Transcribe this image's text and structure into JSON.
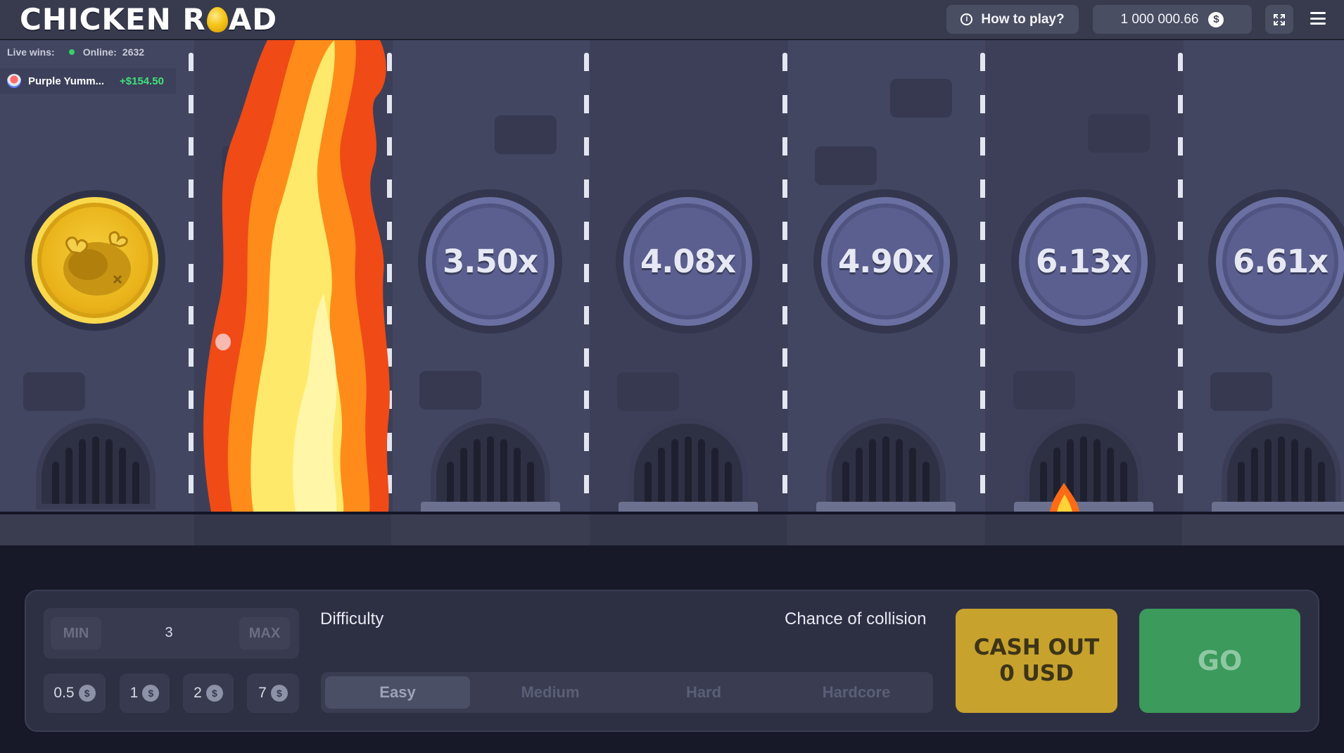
{
  "header": {
    "logo_left": "CHICKEN R",
    "logo_right": "AD",
    "how_to_play": "How to play?",
    "balance": "1 000 000.66",
    "currency_icon": "$"
  },
  "live": {
    "live_wins_label": "Live wins:",
    "online_label": "Online:",
    "online_count": "2632",
    "winner_name": "Purple Yumm...",
    "winner_amount": "+$154.50"
  },
  "lanes": {
    "multipliers": [
      "3.50x",
      "4.08x",
      "4.90x",
      "6.13x",
      "6.61x"
    ]
  },
  "controls": {
    "min_label": "MIN",
    "max_label": "MAX",
    "bet_value": "3",
    "chips": [
      "0.5",
      "1",
      "2",
      "7"
    ],
    "chip_icon": "$",
    "difficulty_label": "Difficulty",
    "collision_label": "Chance of collision",
    "difficulties": [
      "Easy",
      "Medium",
      "Hard",
      "Hardcore"
    ],
    "selected_difficulty": "Easy",
    "cash_out_line1": "CASH OUT",
    "cash_out_line2": "0 USD",
    "go_label": "GO"
  },
  "colors": {
    "background": "#424660",
    "accent_gold": "#c7a22d",
    "accent_green": "#3b9a5c",
    "win_green": "#3ee27a"
  }
}
